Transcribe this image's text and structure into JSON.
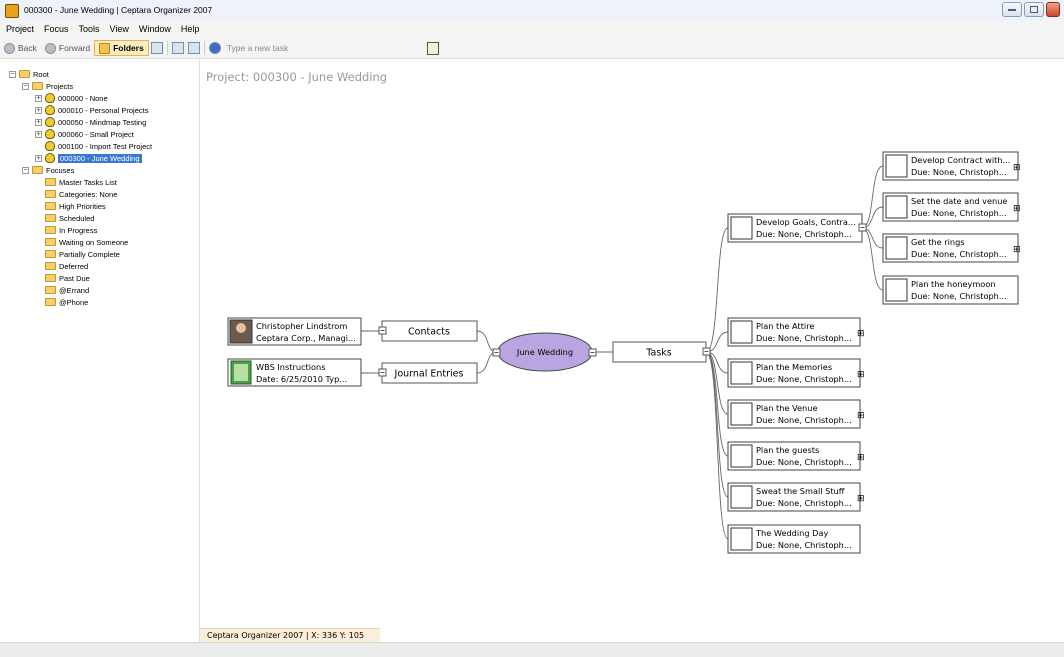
{
  "window": {
    "title": "000300 - June Wedding | Ceptara Organizer 2007"
  },
  "menu": [
    "Project",
    "Focus",
    "Tools",
    "View",
    "Window",
    "Help"
  ],
  "toolbar": {
    "back": "Back",
    "forward": "Forward",
    "folders": "Folders",
    "task_placeholder": "Type a new task"
  },
  "tree": {
    "root": "Root",
    "projects_label": "Projects",
    "projects": [
      {
        "label": "000000 - None",
        "expandable": true
      },
      {
        "label": "000010 - Personal Projects",
        "expandable": true
      },
      {
        "label": "000050 - Mindmap Testing",
        "expandable": true
      },
      {
        "label": "000060 - Small Project",
        "expandable": true
      },
      {
        "label": "000100 - Import Test Project",
        "expandable": false
      },
      {
        "label": "000300 - June Wedding",
        "expandable": true,
        "selected": true
      }
    ],
    "focuses_label": "Focuses",
    "focuses": [
      "Master Tasks List",
      "Categories: None",
      "High Priorities",
      "Scheduled",
      "In Progress",
      "Waiting on Someone",
      "Partially Complete",
      "Deferred",
      "Past Due",
      "@Errand",
      "@Phone"
    ]
  },
  "canvas": {
    "title": "Project: 000300 - June Wedding"
  },
  "mindmap": {
    "center": "June Wedding",
    "contacts": {
      "label": "Contacts",
      "item_line1": "Christopher Lindstrom",
      "item_line2": "Ceptara Corp., Managi..."
    },
    "journal": {
      "label": "Journal Entries",
      "item_line1": "WBS Instructions",
      "item_line2": "Date: 6/25/2010 Typ..."
    },
    "tasks_label": "Tasks",
    "tasks": [
      {
        "line1": "Develop Goals, Contra...",
        "line2": "Due: None, Christoph..."
      },
      {
        "line1": "Plan the Attire",
        "line2": "Due: None, Christoph..."
      },
      {
        "line1": "Plan the Memories",
        "line2": "Due: None, Christoph..."
      },
      {
        "line1": "Plan the Venue",
        "line2": "Due: None, Christoph..."
      },
      {
        "line1": "Plan the guests",
        "line2": "Due: None, Christoph..."
      },
      {
        "line1": "Sweat the Small Stuff",
        "line2": "Due: None, Christoph..."
      },
      {
        "line1": "The Wedding Day",
        "line2": "Due: None, Christoph..."
      }
    ],
    "subtasks": [
      {
        "line1": "Develop Contract with...",
        "line2": "Due: None, Christoph..."
      },
      {
        "line1": "Set the date and venue",
        "line2": "Due: None, Christoph..."
      },
      {
        "line1": "Get the rings",
        "line2": "Due: None, Christoph..."
      },
      {
        "line1": "Plan the honeymoon",
        "line2": "Due: None, Christoph..."
      }
    ]
  },
  "status": {
    "text": "Ceptara Organizer 2007 | X: 336 Y: 105"
  },
  "colors": {
    "center_fill": "#b9a6e0",
    "selection": "#3a78d4",
    "status_bg": "#fbeedb"
  }
}
